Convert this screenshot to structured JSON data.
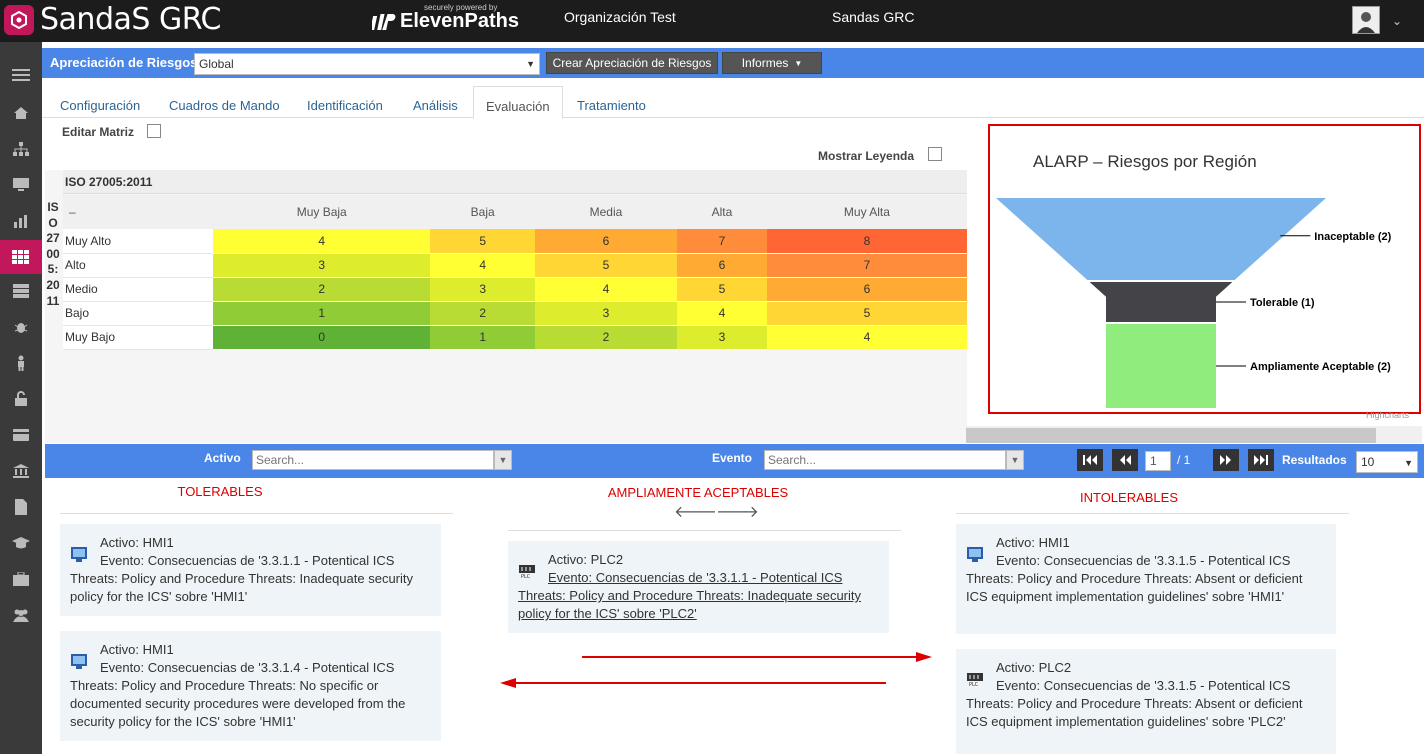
{
  "header": {
    "app_title": "SandaS GRC",
    "powered_small": "securely powered by",
    "powered_brand": "ElevenPaths",
    "organization": "Organización Test",
    "system": "Sandas GRC"
  },
  "toolbar": {
    "label": "Apreciación de Riesgos",
    "select_value": "Global",
    "create_button": "Crear Apreciación de Riesgos",
    "reports_button": "Informes"
  },
  "tabs": [
    {
      "label": "Configuración"
    },
    {
      "label": "Cuadros de Mando"
    },
    {
      "label": "Identificación"
    },
    {
      "label": "Análisis"
    },
    {
      "label": "Evaluación"
    },
    {
      "label": "Tratamiento"
    }
  ],
  "controls": {
    "edit_matrix": "Editar Matriz",
    "show_legend": "Mostrar Leyenda"
  },
  "matrix": {
    "title": "ISO 27005:2011",
    "vertical_title": "ISO27005:2011",
    "corner": "–",
    "columns": [
      "Muy Baja",
      "Baja",
      "Media",
      "Alta",
      "Muy Alta"
    ],
    "rows": [
      {
        "label": "Muy Alto",
        "values": [
          "4",
          "5",
          "6",
          "7",
          "8"
        ]
      },
      {
        "label": "Alto",
        "values": [
          "3",
          "4",
          "5",
          "6",
          "7"
        ]
      },
      {
        "label": "Medio",
        "values": [
          "2",
          "3",
          "4",
          "5",
          "6"
        ]
      },
      {
        "label": "Bajo",
        "values": [
          "1",
          "2",
          "3",
          "4",
          "5"
        ]
      },
      {
        "label": "Muy Bajo",
        "values": [
          "0",
          "1",
          "2",
          "3",
          "4"
        ]
      }
    ],
    "colors": {
      "0": "#5fb236",
      "1": "#8fcc35",
      "2": "#b8dc34",
      "3": "#dded2e",
      "4": "#ffff33",
      "5": "#ffd633",
      "6": "#ffaa33",
      "7": "#ff8c3a",
      "8": "#ff6633"
    }
  },
  "chart_data": {
    "type": "funnel",
    "title": "ALARP – Riesgos por Región",
    "categories": [
      "Inaceptable",
      "Tolerable",
      "Ampliamente Aceptable"
    ],
    "values": [
      2,
      1,
      2
    ],
    "labels": [
      "Inaceptable (2)",
      "Tolerable (1)",
      "Ampliamente Aceptable (2)"
    ],
    "colors": [
      "#7cb5ec",
      "#434348",
      "#90ed7d"
    ],
    "credit": "Highcharts"
  },
  "filters": {
    "asset_label": "Activo",
    "asset_placeholder": "Search...",
    "event_label": "Evento",
    "event_placeholder": "Search...",
    "page": "1",
    "page_total": "/ 1",
    "results_label": "Resultados",
    "results_value": "10"
  },
  "columns": {
    "tolerable": {
      "title": "TOLERABLES",
      "cards": [
        {
          "asset": "Activo: HMI1",
          "event": "Evento: Consecuencias de '3.3.1.1 - Potentical ICS Threats: Policy and Procedure Threats: Inadequate security policy for the ICS' sobre 'HMI1'"
        },
        {
          "asset": "Activo: HMI1",
          "event": "Evento: Consecuencias de '3.3.1.4 - Potentical ICS Threats: Policy and Procedure Threats: No specific or documented security procedures were developed from the security policy for the ICS' sobre 'HMI1'"
        }
      ]
    },
    "acceptable": {
      "title": "AMPLIAMENTE ACEPTABLES",
      "cards": [
        {
          "asset": "Activo: PLC2",
          "event": "Evento: Consecuencias de '3.3.1.1 - Potentical ICS Threats: Policy and Procedure Threats: Inadequate security policy for the ICS' sobre 'PLC2'"
        }
      ]
    },
    "intolerable": {
      "title": "INTOLERABLES",
      "cards": [
        {
          "asset": "Activo: HMI1",
          "event": "Evento: Consecuencias de '3.3.1.5 - Potentical ICS Threats: Policy and Procedure Threats: Absent or deficient ICS equipment implementation guidelines' sobre 'HMI1'"
        },
        {
          "asset": "Activo: PLC2",
          "event": "Evento: Consecuencias de '3.3.1.5 - Potentical ICS Threats: Policy and Procedure Threats: Absent or deficient ICS equipment implementation guidelines' sobre 'PLC2'"
        }
      ]
    }
  }
}
